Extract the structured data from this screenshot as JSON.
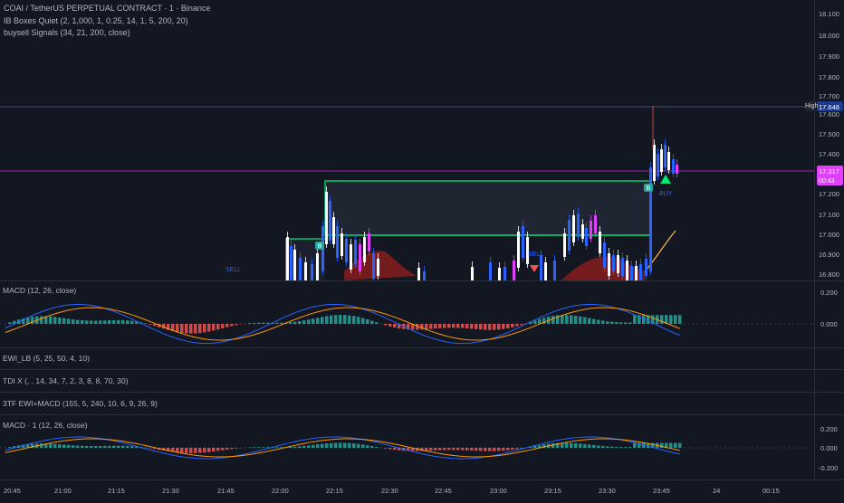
{
  "symbol_line": "COAI / TetherUS PERPETUAL CONTRACT · 1 · Binance",
  "indicators": {
    "ib_boxes": "IB Boxes Quiet (2, 1,000, 1, 0.25, 14, 1, 5, 200, 20)",
    "buysell": "buysell Signals (34, 21, 200, close)"
  },
  "panes": {
    "macd1": "MACD (12, 26, close)",
    "ewi": "EWI_LB (5, 25, 50, 4, 10)",
    "tdi": "TDI X (, , 14, 34, 7, 2, 3, 8, 8, 70, 30)",
    "tf_ewi": "3TF EWI+MACD (155, 5, 240, 10, 6, 9, 26, 9)",
    "macd2": "MACD · 1 (12, 26, close)"
  },
  "price_axis": [
    "18.100",
    "18.000",
    "17.900",
    "17.800",
    "17.700",
    "17.600",
    "17.500",
    "17.400",
    "17.200",
    "17.100",
    "17.000",
    "16.900",
    "16.800"
  ],
  "high_label": "High",
  "high_value": "17.648",
  "current_price": "17.317",
  "countdown": "00:43",
  "macd1_axis": [
    "0.200",
    "0.000"
  ],
  "macd2_axis": [
    "0.200",
    "0.000",
    "-0.200"
  ],
  "time_axis": [
    "20:45",
    "21:00",
    "21:15",
    "21:30",
    "21:45",
    "22:00",
    "22:15",
    "22:30",
    "22:45",
    "23:00",
    "23:15",
    "23:30",
    "23:45",
    "24",
    "00:15"
  ],
  "signals": {
    "sell1": "SELL",
    "sell2": "SELL",
    "buy": "BUY",
    "badge": "B"
  },
  "colors": {
    "up": "#ffffff",
    "down": "#2962ff",
    "magenta": "#e040fb",
    "box": "#00e676",
    "cloud": "#7f1d1d",
    "hist_pos": "#26a69a",
    "hist_neg": "#ef5350",
    "macd_line": "#2962ff",
    "signal_line": "#ff9800"
  }
}
